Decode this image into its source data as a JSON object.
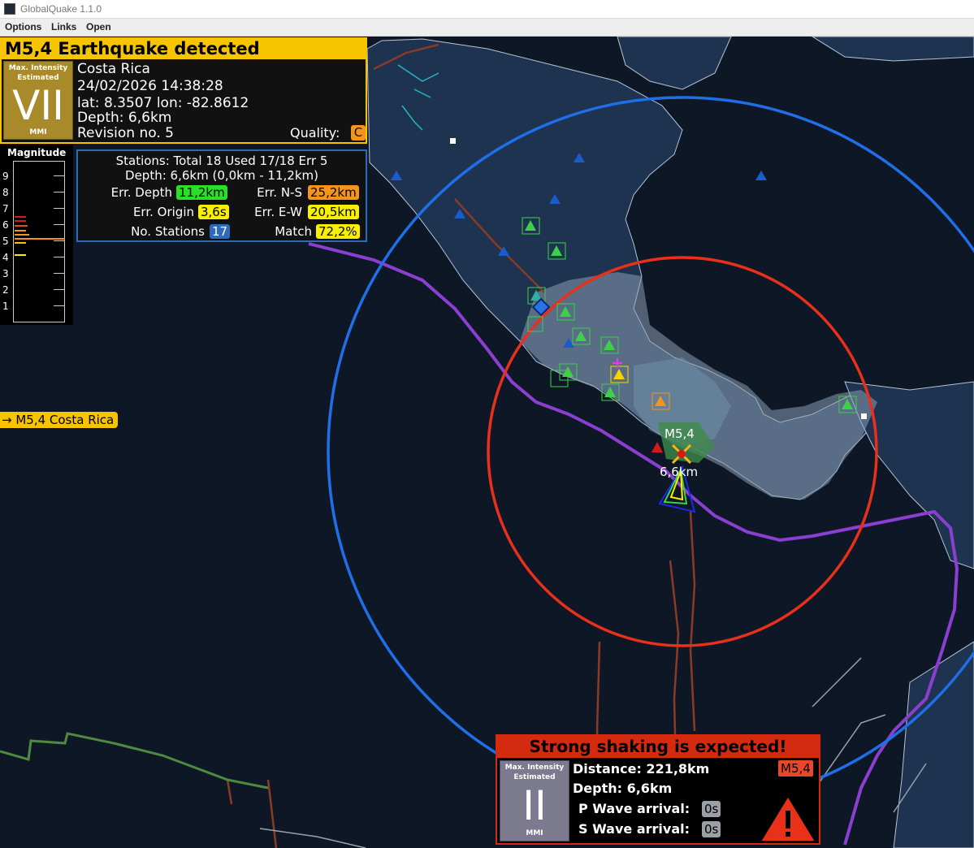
{
  "window": {
    "title": "GlobalQuake 1.1.0"
  },
  "menu": {
    "options": "Options",
    "links": "Links",
    "open": "Open"
  },
  "detection": {
    "header": "M5,4 Earthquake detected",
    "intensity_line1": "Max. Intensity",
    "intensity_line2": "Estimated",
    "intensity_value": "VII",
    "intensity_unit": "MMI",
    "intensity_color": "#a88a2a",
    "region": "Costa Rica",
    "datetime": "24/02/2026 14:38:28",
    "coords": "lat: 8.3507 lon: -82.8612",
    "depth": "Depth: 6,6km",
    "revision": "Revision no. 5",
    "quality_label": "Quality:",
    "quality_value": "C"
  },
  "magnitude_scale": {
    "title": "Magnitude",
    "labels": [
      "9",
      "8",
      "7",
      "6",
      "5",
      "4",
      "3",
      "2",
      "1"
    ],
    "current_magnitude": 5.4
  },
  "stats": {
    "stations": "Stations: Total 18 Used 17/18 Err 5",
    "depth_range": "Depth: 6,6km (0,0km - 11,2km)",
    "err_depth_label": "Err. Depth",
    "err_depth": "11,2km",
    "err_ns_label": "Err. N-S",
    "err_ns": "25,2km",
    "err_origin_label": "Err. Origin",
    "err_origin": "3,6s",
    "err_ew_label": "Err. E-W",
    "err_ew": "20,5km",
    "no_stations_label": "No. Stations",
    "no_stations": "17",
    "match_label": "Match",
    "match": "72,2%",
    "colors": {
      "green": "#27e027",
      "orange": "#f4941b",
      "yellow": "#f7f000",
      "blue": "#2f6ab8"
    }
  },
  "side_tag": "→ M5,4 Costa Rica",
  "map": {
    "epicenter_label": "M5,4",
    "depth_label": "6,6km",
    "p_wave_circle_color": "#1f6fe8",
    "s_wave_circle_color": "#e8301a"
  },
  "alert": {
    "header": "Strong shaking is expected!",
    "intensity_line1": "Max. Intensity",
    "intensity_line2": "Estimated",
    "intensity_value": "II",
    "intensity_unit": "MMI",
    "distance": "Distance: 221,8km",
    "depth": "Depth: 6,6km",
    "magnitude": "M5,4",
    "p_wave_label": "P Wave arrival:",
    "p_wave_value": "0s",
    "s_wave_label": "S Wave arrival:",
    "s_wave_value": "0s",
    "warning_icon": "warning-triangle-icon"
  }
}
